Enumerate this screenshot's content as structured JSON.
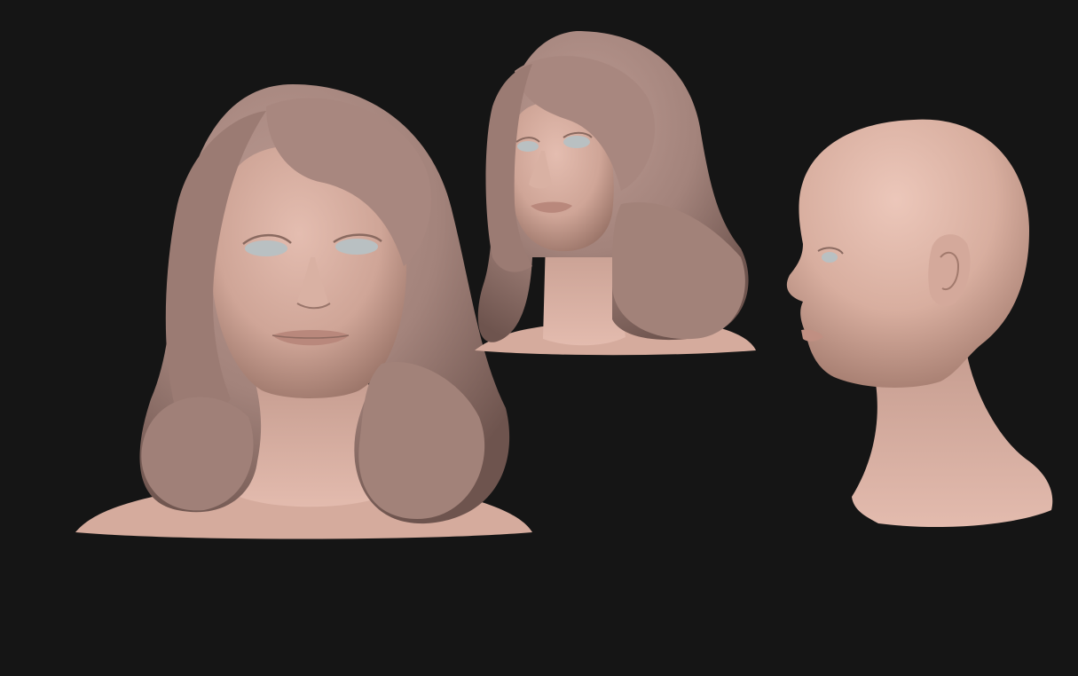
{
  "canvas": {
    "background_color": "#151515"
  },
  "sculpts": [
    {
      "id": "front-view",
      "hair": true
    },
    {
      "id": "three-quarter-view",
      "hair": true
    },
    {
      "id": "profile-view",
      "hair": false
    }
  ],
  "colors": {
    "skin_light": "#e2b9ac",
    "skin_mid": "#c99d90",
    "skin_dark": "#8e6a60",
    "hair_light": "#b8968e",
    "hair_mid": "#a08078",
    "hair_dark": "#6e544e",
    "eye": "#b9c0c2",
    "lip": "#b9887c"
  }
}
